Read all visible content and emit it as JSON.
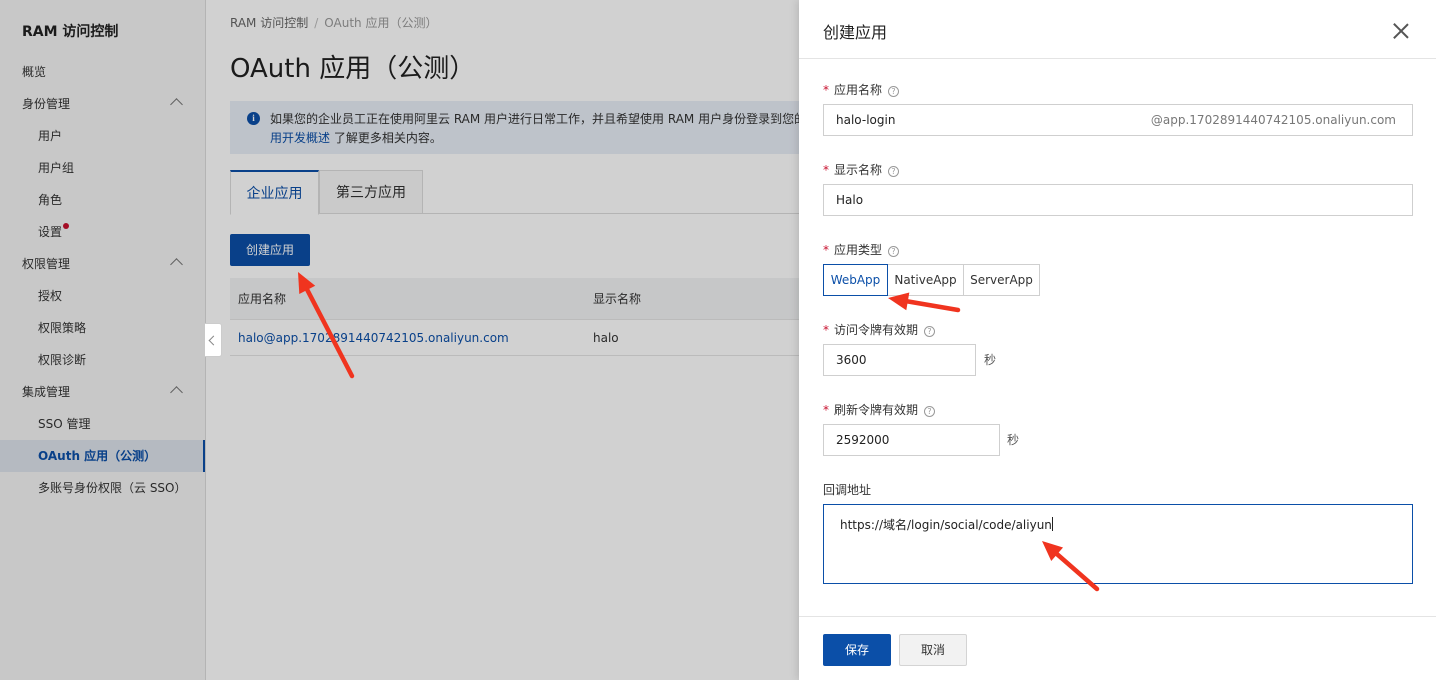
{
  "sidebar": {
    "title": "RAM 访问控制",
    "items": [
      {
        "label": "概览"
      },
      {
        "label": "身份管理"
      },
      {
        "label": "用户"
      },
      {
        "label": "用户组"
      },
      {
        "label": "角色"
      },
      {
        "label": "设置"
      },
      {
        "label": "权限管理"
      },
      {
        "label": "授权"
      },
      {
        "label": "权限策略"
      },
      {
        "label": "权限诊断"
      },
      {
        "label": "集成管理"
      },
      {
        "label": "SSO 管理"
      },
      {
        "label": "OAuth 应用（公测）"
      },
      {
        "label": "多账号身份权限（云 SSO）"
      }
    ]
  },
  "main": {
    "breadcrumb": [
      "RAM 访问控制",
      "OAuth 应用（公测）"
    ],
    "title": "OAuth 应用（公测）",
    "notice": {
      "line1": "如果您的企业员工正在使用阿里云 RAM 用户进行日常工作，并且希望使用 RAM 用户身份登录到您的",
      "link": "用开发概述",
      "line2_rest": " 了解更多相关内容。"
    },
    "tabs": [
      {
        "label": "企业应用"
      },
      {
        "label": "第三方应用"
      }
    ],
    "create_button": "创建应用",
    "table": {
      "columns": [
        "应用名称",
        "显示名称"
      ],
      "rows": [
        {
          "app_name": "halo@app.1702891440742105.onaliyun.com",
          "display_name": "halo"
        }
      ]
    }
  },
  "drawer": {
    "title": "创建应用",
    "app_name": {
      "label": "应用名称",
      "value": "halo-login",
      "suffix": "@app.1702891440742105.onaliyun.com"
    },
    "display_name": {
      "label": "显示名称",
      "value": "Halo"
    },
    "app_type": {
      "label": "应用类型",
      "options": [
        "WebApp",
        "NativeApp",
        "ServerApp"
      ],
      "selected": "WebApp"
    },
    "access_token": {
      "label": "访问令牌有效期",
      "value": "3600",
      "unit": "秒"
    },
    "refresh_token": {
      "label": "刷新令牌有效期",
      "value": "2592000",
      "unit": "秒"
    },
    "callback": {
      "label": "回调地址",
      "value": "https://域名/login/social/code/aliyun"
    },
    "save_label": "保存",
    "cancel_label": "取消",
    "help_glyph": "?"
  },
  "colors": {
    "accent": "#0b4fa8",
    "required": "#c8102e",
    "annotation_arrow": "#f0341f"
  }
}
